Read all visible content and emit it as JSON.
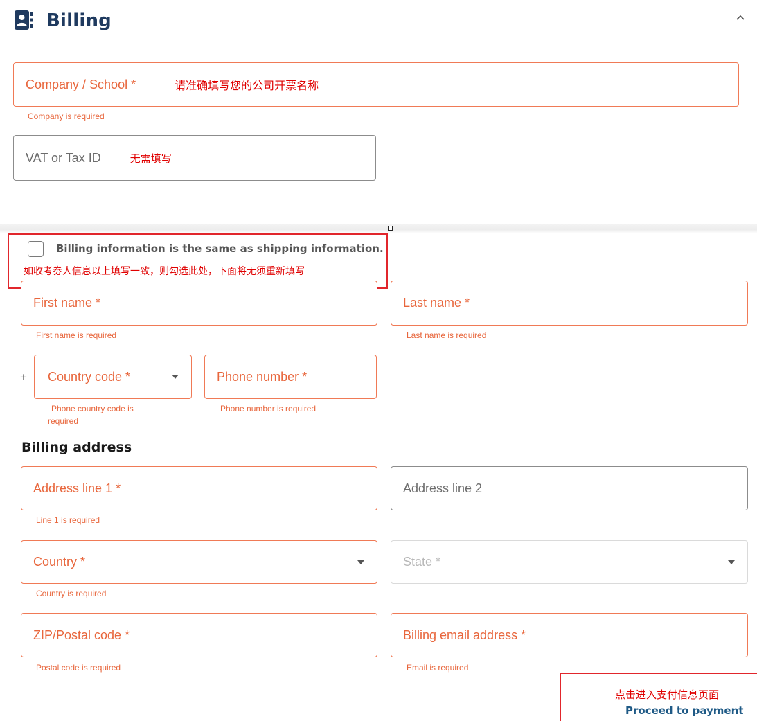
{
  "header": {
    "title": "Billing",
    "icon": "contact-card-icon",
    "collapse_icon": "chevron-up-icon",
    "title_color": "#1f3a5f"
  },
  "company": {
    "label": "Company / School *",
    "note": "请准确填写您的公司开票名称",
    "error": "Company is required"
  },
  "vat": {
    "label": "VAT or Tax ID",
    "note": "无需填写"
  },
  "same_as_shipping": {
    "label": "Billing information is the same as shipping information.",
    "checked": false,
    "note": "如收考劵人信息以上填写一致，则勾选此处，下面将无须重新填写"
  },
  "first_name": {
    "label": "First name *",
    "error": "First name is required"
  },
  "last_name": {
    "label": "Last name *",
    "error": "Last name is required"
  },
  "phone": {
    "prefix": "+",
    "country_code_label": "Country code  *",
    "country_code_error_line1": "Phone country code is",
    "country_code_error_line2": "required",
    "number_label": "Phone number *",
    "number_error": "Phone number is required"
  },
  "billing_address": {
    "title": "Billing address",
    "line1": {
      "label": "Address line 1 *",
      "error": "Line 1 is required"
    },
    "line2": {
      "label": "Address line 2"
    },
    "country": {
      "label": "Country  *",
      "error": "Country is required"
    },
    "state": {
      "label": "State  *"
    },
    "zip": {
      "label": "ZIP/Postal code *",
      "error": "Postal code is required"
    },
    "email": {
      "label": "Billing email address *",
      "error": "Email is required"
    }
  },
  "payment": {
    "note": "点击进入支付信息页面",
    "button": "Proceed to payment"
  },
  "colors": {
    "error": "#e8663c",
    "error_border": "#f07a56",
    "annotation": "#e1262c",
    "link": "#1f5a86"
  }
}
